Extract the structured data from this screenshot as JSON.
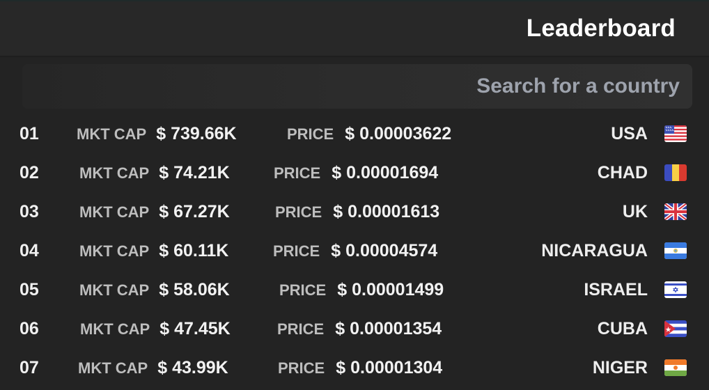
{
  "header": {
    "title": "Leaderboard"
  },
  "search": {
    "placeholder": "Search for a country",
    "value": ""
  },
  "labels": {
    "mkt_cap": "MKT CAP",
    "price": "PRICE"
  },
  "rows": [
    {
      "rank": "01",
      "mkt_cap": "$ 739.66K",
      "price": "$ 0.00003622",
      "country": "USA",
      "flag": "usa-flag-icon"
    },
    {
      "rank": "02",
      "mkt_cap": "$ 74.21K",
      "price": "$ 0.00001694",
      "country": "CHAD",
      "flag": "chad-flag-icon"
    },
    {
      "rank": "03",
      "mkt_cap": "$ 67.27K",
      "price": "$ 0.00001613",
      "country": "UK",
      "flag": "uk-flag-icon"
    },
    {
      "rank": "04",
      "mkt_cap": "$ 60.11K",
      "price": "$ 0.00004574",
      "country": "NICARAGUA",
      "flag": "nicaragua-flag-icon"
    },
    {
      "rank": "05",
      "mkt_cap": "$ 58.06K",
      "price": "$ 0.00001499",
      "country": "ISRAEL",
      "flag": "israel-flag-icon"
    },
    {
      "rank": "06",
      "mkt_cap": "$ 47.45K",
      "price": "$ 0.00001354",
      "country": "CUBA",
      "flag": "cuba-flag-icon"
    },
    {
      "rank": "07",
      "mkt_cap": "$ 43.99K",
      "price": "$ 0.00001304",
      "country": "NIGER",
      "flag": "niger-flag-icon"
    }
  ]
}
